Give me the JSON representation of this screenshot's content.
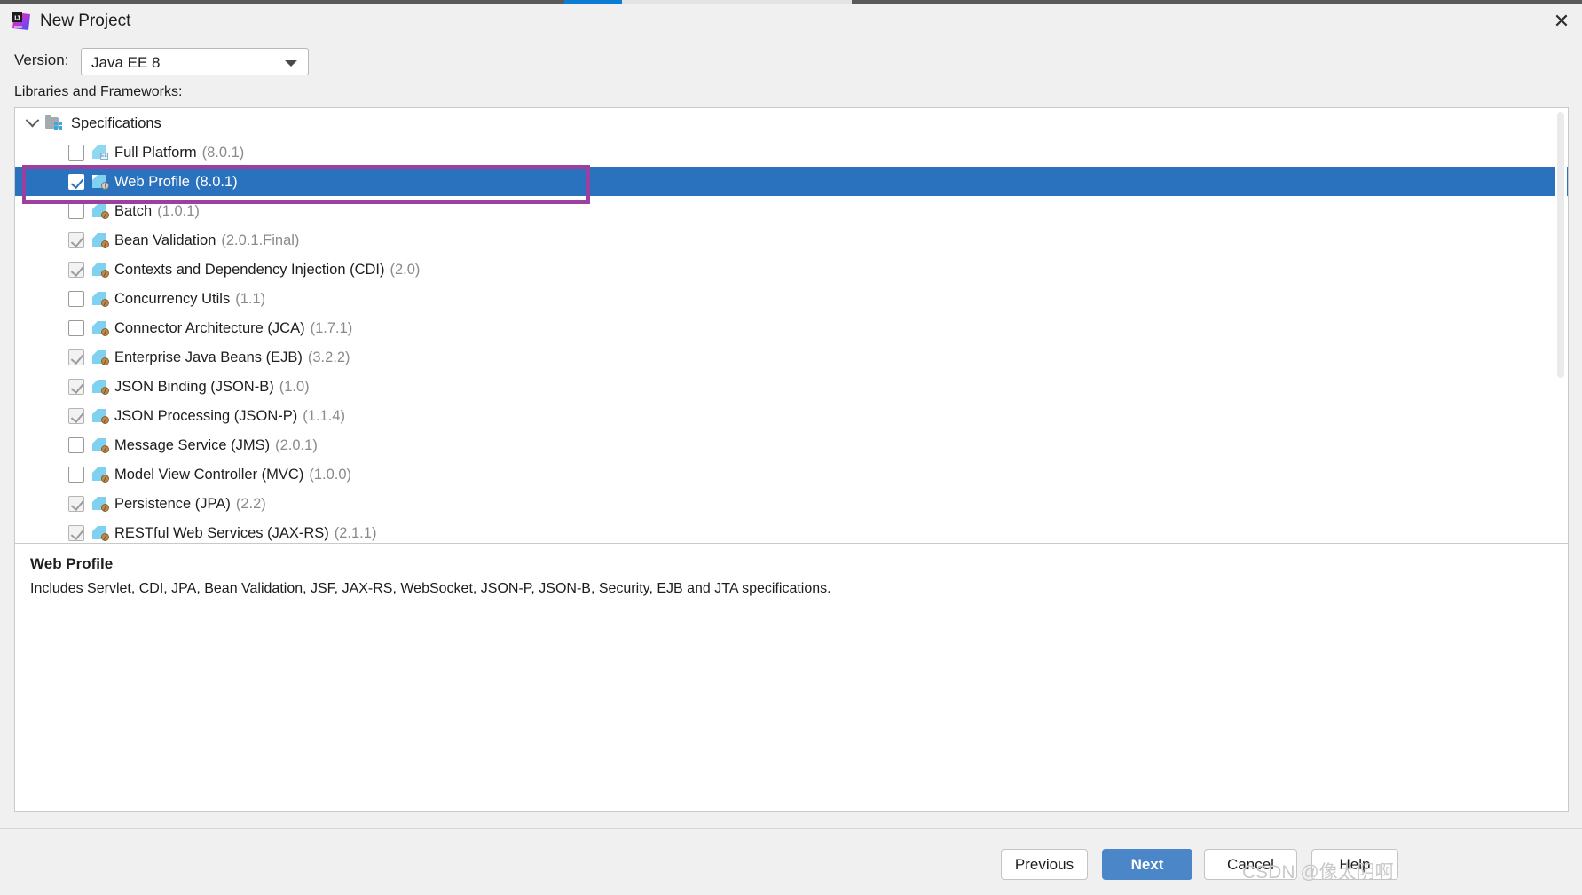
{
  "window": {
    "title": "New Project",
    "app_icon": "intellij-idea-icon",
    "close_label": "✕"
  },
  "version_row": {
    "label": "Version:",
    "selected": "Java EE 8",
    "options": [
      "Java EE 8"
    ]
  },
  "libraries_section": {
    "label": "Libraries and Frameworks:"
  },
  "tree": {
    "group": {
      "label": "Specifications",
      "expanded": true,
      "icon": "spec-folder-icon"
    },
    "items": [
      {
        "label": "Full Platform",
        "version": "(8.0.1)",
        "state": "unchecked",
        "icon": "ee-spec-icon",
        "selected": false
      },
      {
        "label": "Web Profile",
        "version": "(8.0.1)",
        "state": "checked",
        "icon": "web-profile-icon",
        "selected": true
      },
      {
        "label": "Batch",
        "version": "(1.0.1)",
        "state": "unchecked",
        "icon": "java-spec-icon",
        "selected": false
      },
      {
        "label": "Bean Validation",
        "version": "(2.0.1.Final)",
        "state": "implied",
        "icon": "java-spec-icon",
        "selected": false
      },
      {
        "label": "Contexts and Dependency Injection (CDI)",
        "version": "(2.0)",
        "state": "implied",
        "icon": "java-spec-icon",
        "selected": false
      },
      {
        "label": "Concurrency Utils",
        "version": "(1.1)",
        "state": "unchecked",
        "icon": "java-spec-icon",
        "selected": false
      },
      {
        "label": "Connector Architecture (JCA)",
        "version": "(1.7.1)",
        "state": "unchecked",
        "icon": "java-spec-icon",
        "selected": false
      },
      {
        "label": "Enterprise Java Beans (EJB)",
        "version": "(3.2.2)",
        "state": "implied",
        "icon": "java-spec-icon",
        "selected": false
      },
      {
        "label": "JSON Binding (JSON-B)",
        "version": "(1.0)",
        "state": "implied",
        "icon": "java-spec-icon",
        "selected": false
      },
      {
        "label": "JSON Processing (JSON-P)",
        "version": "(1.1.4)",
        "state": "implied",
        "icon": "java-spec-icon",
        "selected": false
      },
      {
        "label": "Message Service (JMS)",
        "version": "(2.0.1)",
        "state": "unchecked",
        "icon": "java-spec-icon",
        "selected": false
      },
      {
        "label": "Model View Controller (MVC)",
        "version": "(1.0.0)",
        "state": "unchecked",
        "icon": "java-spec-icon",
        "selected": false
      },
      {
        "label": "Persistence (JPA)",
        "version": "(2.2)",
        "state": "implied",
        "icon": "java-spec-icon",
        "selected": false
      },
      {
        "label": "RESTful Web Services (JAX-RS)",
        "version": "(2.1.1)",
        "state": "implied",
        "icon": "java-spec-icon",
        "selected": false
      }
    ]
  },
  "description": {
    "title": "Web Profile",
    "text": "Includes Servlet, CDI, JPA, Bean Validation, JSF, JAX-RS, WebSocket, JSON-P, JSON-B, Security, EJB and JTA specifications."
  },
  "buttons": {
    "previous": "Previous",
    "next": "Next",
    "cancel": "Cancel",
    "help": "Help"
  },
  "watermark": {
    "line1": "CSDN @像太阴啊"
  },
  "colors": {
    "selection_blue": "#2a72bd",
    "annotation_purple": "#9c3f9e",
    "primary_button": "#4a86c8",
    "tab_indicator_blue": "#0a7cd4",
    "version_text_gray": "#8a8a8a"
  }
}
